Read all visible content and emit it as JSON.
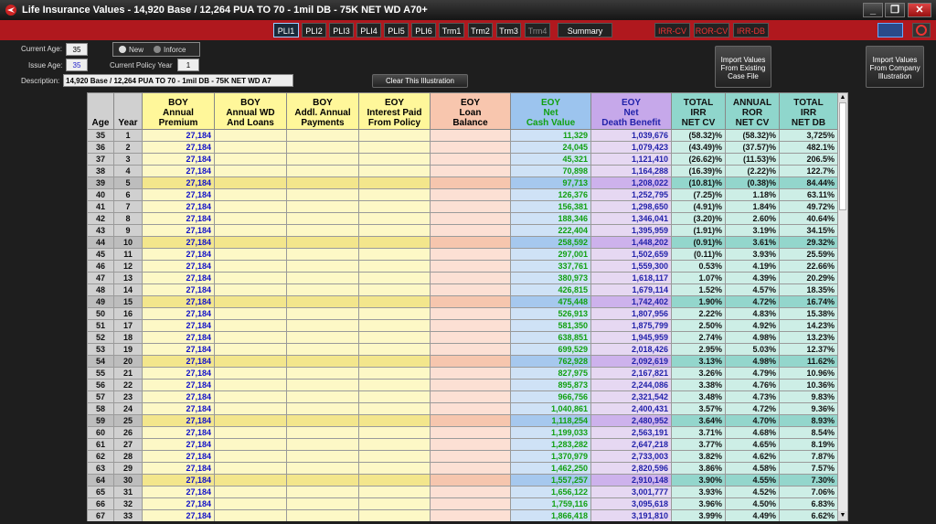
{
  "window": {
    "title": "Life Insurance Values - 14,920 Base / 12,264 PUA TO 70 - 1mil DB  - 75K NET WD A70+",
    "minimize": "_",
    "restore": "❐",
    "close": "✕"
  },
  "tabs": [
    "PLI1",
    "PLI2",
    "PLI3",
    "PLI4",
    "PLI5",
    "PLI6",
    "Trm1",
    "Trm2",
    "Trm3",
    "Trm4",
    "Summary"
  ],
  "red_tabs": [
    "IRR-CV",
    "ROR-CV",
    "IRR-DB"
  ],
  "controls": {
    "current_age_label": "Current Age:",
    "current_age": "35",
    "issue_age_label": "Issue Age:",
    "issue_age": "35",
    "radio_new": "New",
    "radio_inforce": "Inforce",
    "policy_year_label": "Current Policy Year",
    "policy_year": "1",
    "description_label": "Description:",
    "description": "14,920 Base / 12,264 PUA TO 70 - 1mil DB  - 75K NET WD A7",
    "clear_button": "Clear This Illustration",
    "import_case": "Import Values From Existing Case File",
    "import_company": "Import Values From Company Illustration"
  },
  "headers": {
    "age": "Age",
    "year": "Year",
    "prem": [
      "BOY",
      "Annual",
      "Premium"
    ],
    "wd": [
      "BOY",
      "Annual WD",
      "And Loans"
    ],
    "addl": [
      "BOY",
      "Addl. Annual",
      "Payments"
    ],
    "int": [
      "EOY",
      "Interest Paid",
      "From Policy"
    ],
    "loan": [
      "EOY",
      "Loan",
      "Balance"
    ],
    "cv": [
      "EOY",
      "Net",
      "Cash Value"
    ],
    "db": [
      "EOY",
      "Net",
      "Death Benefit"
    ],
    "irr": [
      "TOTAL",
      "IRR",
      "NET CV"
    ],
    "ror": [
      "ANNUAL",
      "ROR",
      "NET CV"
    ],
    "irrdb": [
      "TOTAL",
      "IRR",
      "NET DB"
    ]
  },
  "rows": [
    [
      "35",
      "1",
      "27,184",
      "11,329",
      "1,039,676",
      "(58.32)%",
      "(58.32)%",
      "3,725%"
    ],
    [
      "36",
      "2",
      "27,184",
      "24,045",
      "1,079,423",
      "(43.49)%",
      "(37.57)%",
      "482.1%"
    ],
    [
      "37",
      "3",
      "27,184",
      "45,321",
      "1,121,410",
      "(26.62)%",
      "(11.53)%",
      "206.5%"
    ],
    [
      "38",
      "4",
      "27,184",
      "70,898",
      "1,164,288",
      "(16.39)%",
      "(2.22)%",
      "122.7%"
    ],
    [
      "39",
      "5",
      "27,184",
      "97,713",
      "1,208,022",
      "(10.81)%",
      "(0.38)%",
      "84.44%"
    ],
    [
      "40",
      "6",
      "27,184",
      "126,376",
      "1,252,795",
      "(7.25)%",
      "1.18%",
      "63.11%"
    ],
    [
      "41",
      "7",
      "27,184",
      "156,381",
      "1,298,650",
      "(4.91)%",
      "1.84%",
      "49.72%"
    ],
    [
      "42",
      "8",
      "27,184",
      "188,346",
      "1,346,041",
      "(3.20)%",
      "2.60%",
      "40.64%"
    ],
    [
      "43",
      "9",
      "27,184",
      "222,404",
      "1,395,959",
      "(1.91)%",
      "3.19%",
      "34.15%"
    ],
    [
      "44",
      "10",
      "27,184",
      "258,592",
      "1,448,202",
      "(0.91)%",
      "3.61%",
      "29.32%"
    ],
    [
      "45",
      "11",
      "27,184",
      "297,001",
      "1,502,659",
      "(0.11)%",
      "3.93%",
      "25.59%"
    ],
    [
      "46",
      "12",
      "27,184",
      "337,761",
      "1,559,300",
      "0.53%",
      "4.19%",
      "22.66%"
    ],
    [
      "47",
      "13",
      "27,184",
      "380,973",
      "1,618,117",
      "1.07%",
      "4.39%",
      "20.29%"
    ],
    [
      "48",
      "14",
      "27,184",
      "426,815",
      "1,679,114",
      "1.52%",
      "4.57%",
      "18.35%"
    ],
    [
      "49",
      "15",
      "27,184",
      "475,448",
      "1,742,402",
      "1.90%",
      "4.72%",
      "16.74%"
    ],
    [
      "50",
      "16",
      "27,184",
      "526,913",
      "1,807,956",
      "2.22%",
      "4.83%",
      "15.38%"
    ],
    [
      "51",
      "17",
      "27,184",
      "581,350",
      "1,875,799",
      "2.50%",
      "4.92%",
      "14.23%"
    ],
    [
      "52",
      "18",
      "27,184",
      "638,851",
      "1,945,959",
      "2.74%",
      "4.98%",
      "13.23%"
    ],
    [
      "53",
      "19",
      "27,184",
      "699,529",
      "2,018,426",
      "2.95%",
      "5.03%",
      "12.37%"
    ],
    [
      "54",
      "20",
      "27,184",
      "762,928",
      "2,092,619",
      "3.13%",
      "4.98%",
      "11.62%"
    ],
    [
      "55",
      "21",
      "27,184",
      "827,975",
      "2,167,821",
      "3.26%",
      "4.79%",
      "10.96%"
    ],
    [
      "56",
      "22",
      "27,184",
      "895,873",
      "2,244,086",
      "3.38%",
      "4.76%",
      "10.36%"
    ],
    [
      "57",
      "23",
      "27,184",
      "966,756",
      "2,321,542",
      "3.48%",
      "4.73%",
      "9.83%"
    ],
    [
      "58",
      "24",
      "27,184",
      "1,040,861",
      "2,400,431",
      "3.57%",
      "4.72%",
      "9.36%"
    ],
    [
      "59",
      "25",
      "27,184",
      "1,118,254",
      "2,480,952",
      "3.64%",
      "4.70%",
      "8.93%"
    ],
    [
      "60",
      "26",
      "27,184",
      "1,199,033",
      "2,563,191",
      "3.71%",
      "4.68%",
      "8.54%"
    ],
    [
      "61",
      "27",
      "27,184",
      "1,283,282",
      "2,647,218",
      "3.77%",
      "4.65%",
      "8.19%"
    ],
    [
      "62",
      "28",
      "27,184",
      "1,370,979",
      "2,733,003",
      "3.82%",
      "4.62%",
      "7.87%"
    ],
    [
      "63",
      "29",
      "27,184",
      "1,462,250",
      "2,820,596",
      "3.86%",
      "4.58%",
      "7.57%"
    ],
    [
      "64",
      "30",
      "27,184",
      "1,557,257",
      "2,910,148",
      "3.90%",
      "4.55%",
      "7.30%"
    ],
    [
      "65",
      "31",
      "27,184",
      "1,656,122",
      "3,001,777",
      "3.93%",
      "4.52%",
      "7.06%"
    ],
    [
      "66",
      "32",
      "27,184",
      "1,759,116",
      "3,095,618",
      "3.96%",
      "4.50%",
      "6.83%"
    ],
    [
      "67",
      "33",
      "27,184",
      "1,866,418",
      "3,191,810",
      "3.99%",
      "4.49%",
      "6.62%"
    ]
  ],
  "colors": {
    "accent_red": "#b0181e",
    "active_tab": "#9cf"
  }
}
